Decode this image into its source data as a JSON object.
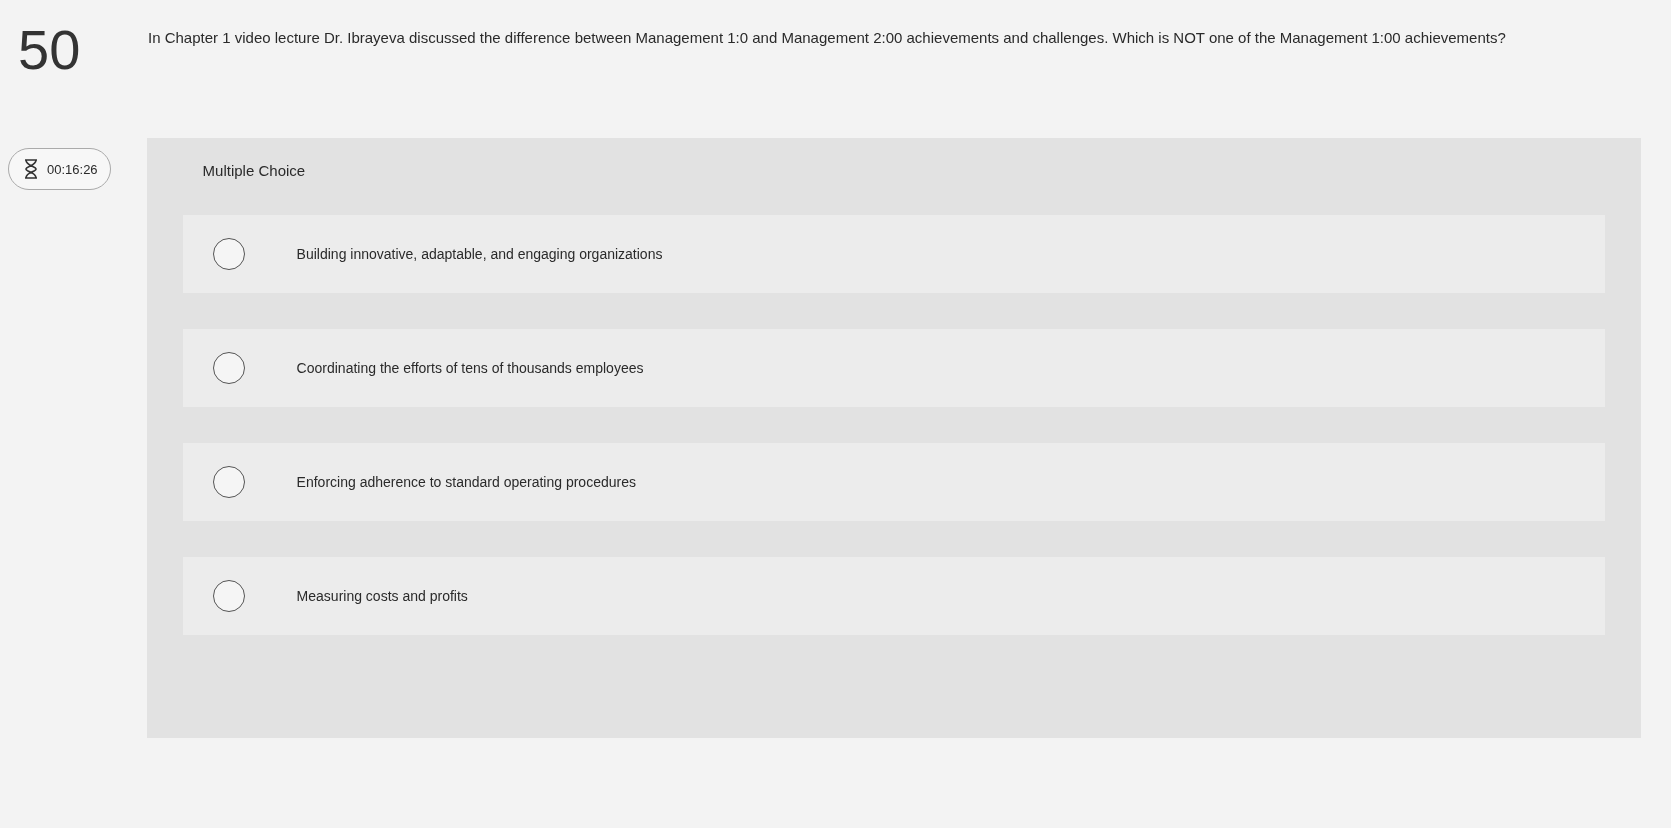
{
  "question": {
    "number": "50",
    "text": "In Chapter 1 video lecture Dr. Ibrayeva discussed the difference between Management 1:0 and Management 2:00 achievements and challenges. Which is NOT one of the Management 1:00 achievements?"
  },
  "timer": {
    "time": "00:16:26"
  },
  "panel": {
    "type_label": "Multiple Choice",
    "options": [
      {
        "label": "Building innovative, adaptable, and engaging organizations",
        "selected": false
      },
      {
        "label": "Coordinating the efforts of tens of thousands employees",
        "selected": false
      },
      {
        "label": "Enforcing adherence to standard operating procedures",
        "selected": false
      },
      {
        "label": "Measuring costs and profits",
        "selected": false
      }
    ]
  }
}
